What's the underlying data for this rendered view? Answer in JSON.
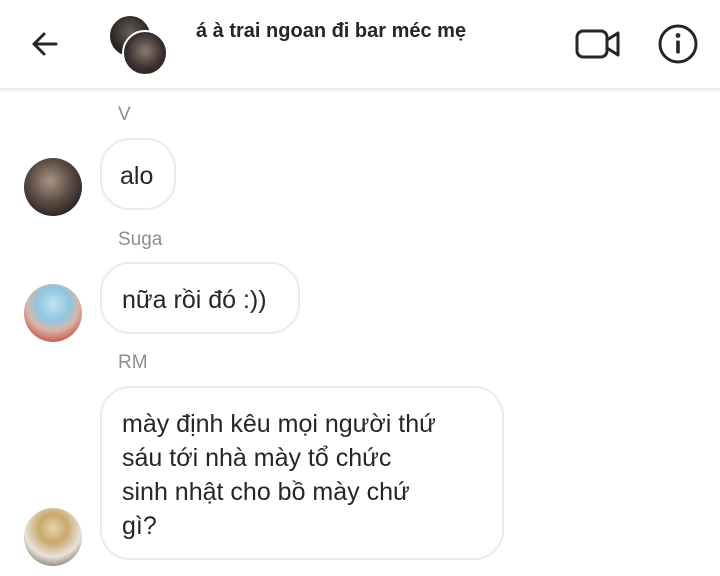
{
  "header": {
    "title": "á à trai ngoan đi bar méc mẹ",
    "icons": {
      "back": "back-arrow-icon",
      "video": "video-call-icon",
      "info": "info-icon"
    }
  },
  "messages": [
    {
      "sender": "V",
      "text": "alo"
    },
    {
      "sender": "Suga",
      "text": "nữa rồi đó :))"
    },
    {
      "sender": "RM",
      "lines": [
        "mày định kêu mọi người thứ",
        "sáu tới nhà mày tổ chức",
        "sinh nhật cho bồ mày chứ",
        "gì?"
      ]
    }
  ],
  "colors": {
    "text": "#262626",
    "secondary_text": "#8e8e8e",
    "bubble_border": "#ebebeb",
    "background": "#ffffff"
  }
}
